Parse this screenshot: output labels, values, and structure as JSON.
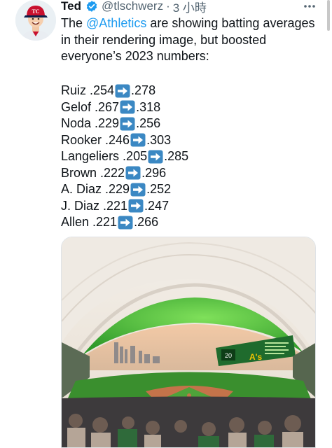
{
  "tweet": {
    "author_name": "Ted",
    "handle": "@tlschwerz",
    "separator": "·",
    "time": "3 小時",
    "text_part1": "The ",
    "mention": "@Athletics",
    "text_part2": " are showing batting averages in their rendering image, but boosted everyone’s 2023 numbers:",
    "stats": [
      {
        "label": "Ruiz .254",
        "after": ".278"
      },
      {
        "label": "Gelof .267",
        "after": ".318"
      },
      {
        "label": "Noda .229",
        "after": ".256"
      },
      {
        "label": "Rooker .246",
        "after": ".303"
      },
      {
        "label": "Langeliers .205",
        "after": ".285"
      },
      {
        "label": "Brown .222",
        "after": ".296"
      },
      {
        "label": "A. Diaz .229",
        "after": ".252"
      },
      {
        "label": "J. Diaz .221",
        "after": ".247"
      },
      {
        "label": "Allen .221",
        "after": ".266"
      }
    ],
    "scoreboard_number": "20"
  },
  "icons": {
    "verified": "verified-badge-icon",
    "arrow": "right-arrow-emoji-icon",
    "more": "more-options-icon"
  },
  "colors": {
    "mention": "#1d9bf0",
    "verified": "#1d9bf0",
    "arrow_emoji": "#3b88c3",
    "field_green": "#3a8f2e",
    "canopy_glow": "#52c13a"
  }
}
